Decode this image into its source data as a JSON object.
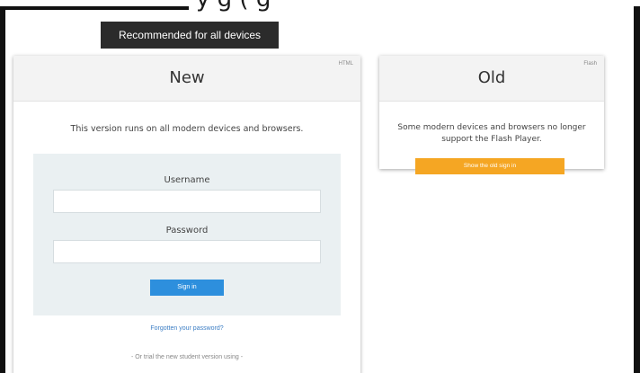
{
  "top_cropped_text": "y                              g              (         g",
  "badge": {
    "label": "Recommended for all devices"
  },
  "new_card": {
    "title": "New",
    "tag": "HTML",
    "description": "This version runs on all modern devices and browsers.",
    "username_label": "Username",
    "username_value": "",
    "password_label": "Password",
    "password_value": "",
    "signin_label": "Sign in",
    "forgot_link": "Forgotten your password?",
    "trial_text": "- Or trial the new student version using -"
  },
  "old_card": {
    "title": "Old",
    "tag": "Flash",
    "description": "Some modern devices and browsers no longer support the Flash Player.",
    "button_label": "Show the old sign in"
  },
  "colors": {
    "badge_bg": "#2b2b2b",
    "panel_bg": "#eaf0f2",
    "signin_blue": "#2d8fdd",
    "old_button_orange": "#f5a623",
    "link_blue": "#3b7dc4"
  }
}
